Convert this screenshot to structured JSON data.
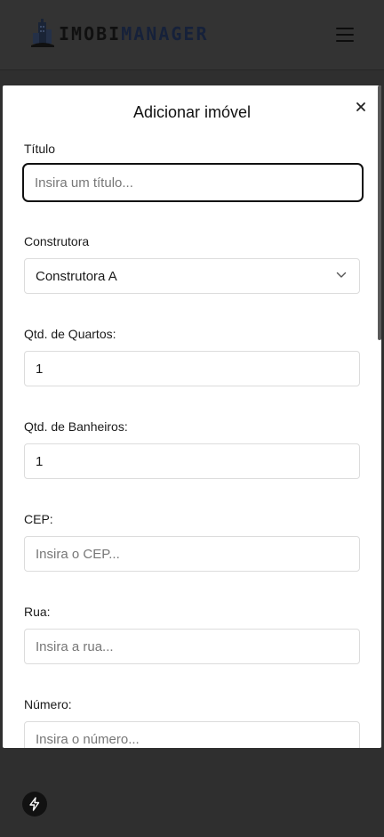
{
  "header": {
    "logo_part1": "IMOBI",
    "logo_part2": "MANAGER",
    "menu_icon": "hamburger-icon"
  },
  "modal": {
    "title": "Adicionar imóvel",
    "close_icon": "close-icon",
    "fields": {
      "titulo": {
        "label": "Título",
        "placeholder": "Insira um título..."
      },
      "construtora": {
        "label": "Construtora",
        "value": "Construtora A"
      },
      "quartos": {
        "label": "Qtd. de Quartos:",
        "value": "1"
      },
      "banheiros": {
        "label": "Qtd. de Banheiros:",
        "value": "1"
      },
      "cep": {
        "label": "CEP:",
        "placeholder": "Insira o CEP..."
      },
      "rua": {
        "label": "Rua:",
        "placeholder": "Insira a rua..."
      },
      "numero": {
        "label": "Número:",
        "placeholder": "Insira o número..."
      }
    }
  },
  "dev_badge": {
    "icon": "lightning-icon"
  },
  "colors": {
    "backdrop": "#2f2f2f",
    "topbar": "#333333",
    "focus_border": "#111111"
  }
}
